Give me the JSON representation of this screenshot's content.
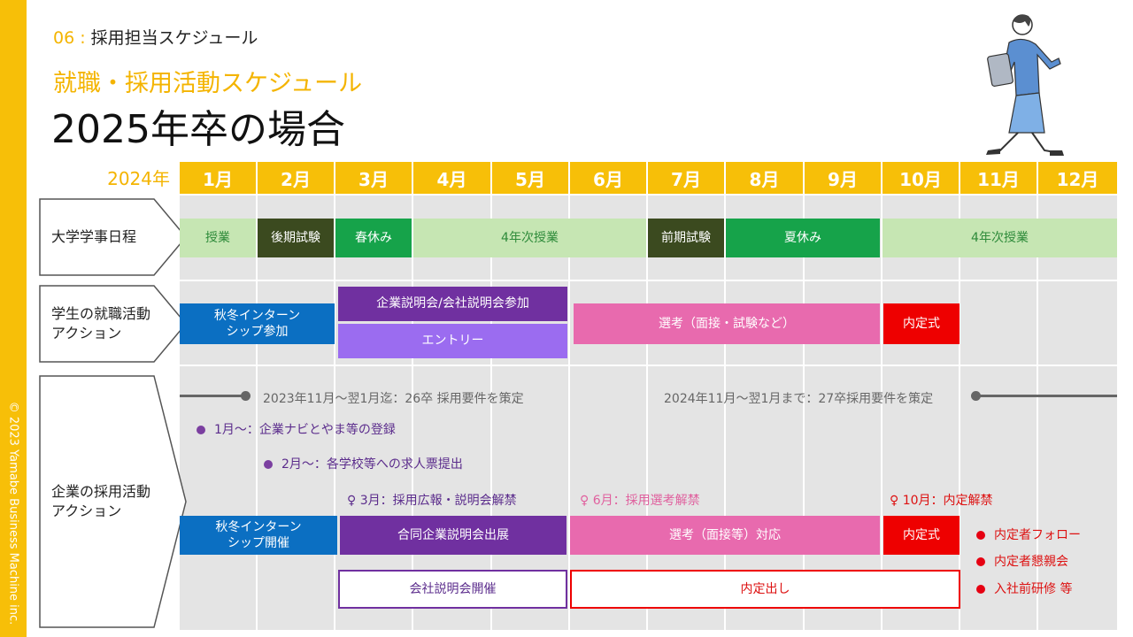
{
  "copyright": "© 2023 Yamabe Business Machine inc.",
  "section": {
    "number": "06 :",
    "label": "採用担当スケジュール"
  },
  "subtitle": "就職・採用活動スケジュール",
  "title": "2025年卒の場合",
  "year_label": "2024年",
  "months": [
    "1月",
    "2月",
    "3月",
    "4月",
    "5月",
    "6月",
    "7月",
    "8月",
    "9月",
    "10月",
    "11月",
    "12月"
  ],
  "rows": {
    "academic": "大学学事日程",
    "student_line1": "学生の就職活動",
    "student_line2": "アクション",
    "company_line1": "企業の採用活動",
    "company_line2": "アクション"
  },
  "academic_bars": [
    {
      "label": "授業",
      "color": "#c6e6b3",
      "text_color": "#2e8b3a"
    },
    {
      "label": "後期試験",
      "color": "#3b4a1f",
      "text_color": "#ffffff"
    },
    {
      "label": "春休み",
      "color": "#16a34a",
      "text_color": "#ffffff"
    },
    {
      "label": "4年次授業",
      "color": "#c6e6b3",
      "text_color": "#2e8b3a"
    },
    {
      "label": "前期試験",
      "color": "#3b4a1f",
      "text_color": "#ffffff"
    },
    {
      "label": "夏休み",
      "color": "#16a34a",
      "text_color": "#ffffff"
    },
    {
      "label": "4年次授業",
      "color": "#c6e6b3",
      "text_color": "#2e8b3a"
    }
  ],
  "student_bars": {
    "internship_line1": "秋冬インターン",
    "internship_line2": "シップ参加",
    "briefing": "企業説明会/会社説明会参加",
    "entry": "エントリー",
    "selection": "選考（面接・試験など）",
    "ceremony": "内定式"
  },
  "company": {
    "req_2023": "2023年11月～翌1月迄：26卒 採用要件を策定",
    "req_2024": "2024年11月～翌1月まで：27卒採用要件を策定",
    "navi": "1月～：企業ナビとやま等の登録",
    "school": "2月～：各学校等への求人票提出",
    "pin_march": "3月：採用広報・説明会解禁",
    "pin_june": "6月：採用選考解禁",
    "pin_oct": "10月：内定解禁",
    "internship_line1": "秋冬インターン",
    "internship_line2": "シップ開催",
    "joint_fair": "合同企業説明会出展",
    "selection": "選考（面接等）対応",
    "ceremony": "内定式",
    "company_briefing": "会社説明会開催",
    "offers": "内定出し",
    "followups": [
      "内定者フォロー",
      "内定者懇親会",
      "入社前研修 等"
    ]
  },
  "colors": {
    "accent": "#f7bf08",
    "blue": "#0b6fc2",
    "purple": "#7030a0",
    "light_purple": "#9b6cf0",
    "pink": "#e86aae",
    "red": "#ee0000"
  }
}
